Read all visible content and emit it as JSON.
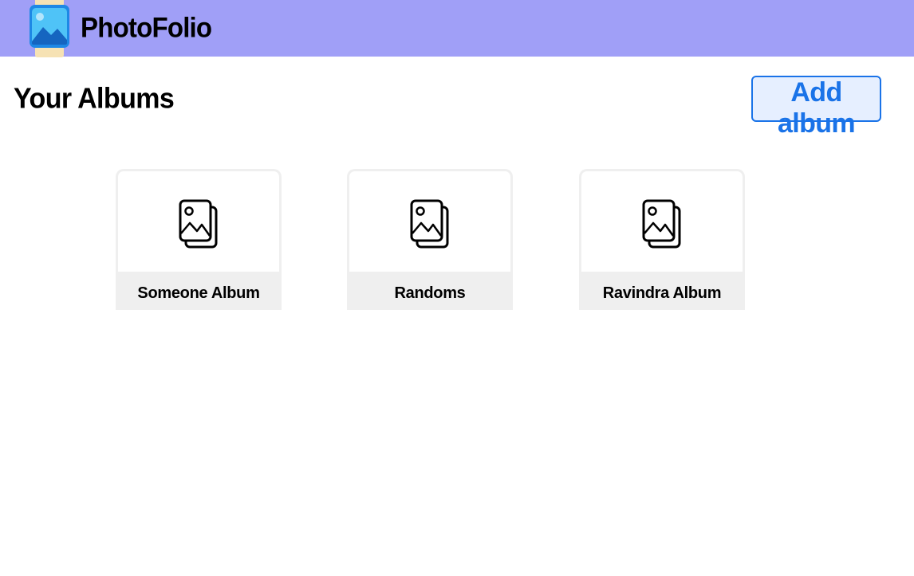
{
  "navbar": {
    "brand": "PhotoFolio",
    "logo_icon": "photo-folio-logo-icon",
    "background": "#a09ff7"
  },
  "main": {
    "title": "Your Albums",
    "add_button_label": "Add album",
    "accent_color": "#1a73e8",
    "albums": [
      {
        "name": "Someone Album",
        "icon": "images-icon"
      },
      {
        "name": "Randoms",
        "icon": "images-icon"
      },
      {
        "name": "Ravindra Album",
        "icon": "images-icon"
      }
    ]
  }
}
